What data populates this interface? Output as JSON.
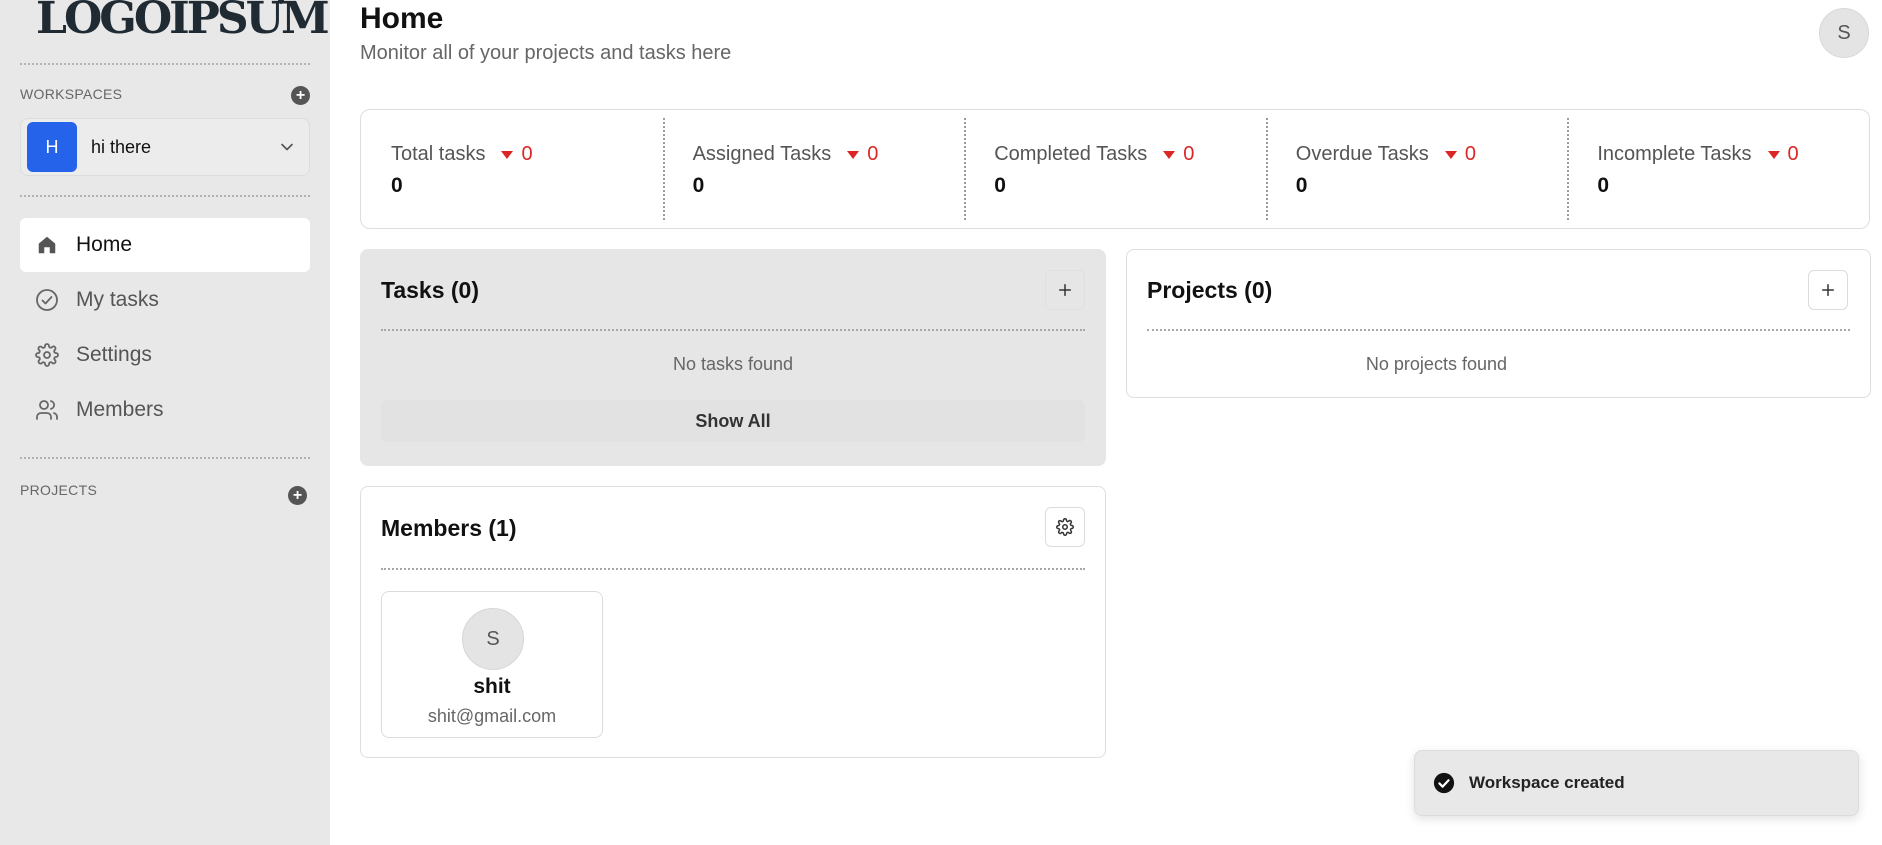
{
  "sidebar": {
    "logo_text": "LOGOIPSUM",
    "workspaces_label": "WORKSPACES",
    "workspace": {
      "initial": "H",
      "name": "hi there"
    },
    "nav": [
      {
        "label": "Home",
        "icon": "home-icon",
        "active": true
      },
      {
        "label": "My tasks",
        "icon": "check-circle-icon",
        "active": false
      },
      {
        "label": "Settings",
        "icon": "gear-icon",
        "active": false
      },
      {
        "label": "Members",
        "icon": "users-icon",
        "active": false
      }
    ],
    "projects_label": "PROJECTS"
  },
  "header": {
    "title": "Home",
    "subtitle": "Monitor all of your projects and tasks here",
    "user_initial": "S"
  },
  "stats": [
    {
      "label": "Total tasks",
      "delta": "0",
      "value": "0"
    },
    {
      "label": "Assigned Tasks",
      "delta": "0",
      "value": "0"
    },
    {
      "label": "Completed Tasks",
      "delta": "0",
      "value": "0"
    },
    {
      "label": "Overdue Tasks",
      "delta": "0",
      "value": "0"
    },
    {
      "label": "Incomplete Tasks",
      "delta": "0",
      "value": "0"
    }
  ],
  "tasks": {
    "title": "Tasks (0)",
    "empty": "No tasks found",
    "show_all": "Show All"
  },
  "projects": {
    "title": "Projects (0)",
    "empty": "No projects found"
  },
  "members": {
    "title": "Members (1)",
    "list": [
      {
        "initial": "S",
        "name": "shit",
        "email": "shit@gmail.com"
      }
    ]
  },
  "toast": {
    "text": "Workspace created"
  },
  "colors": {
    "accent_blue": "#2563eb",
    "negative_red": "#dc2626",
    "sidebar_bg": "#e8e8e8"
  }
}
